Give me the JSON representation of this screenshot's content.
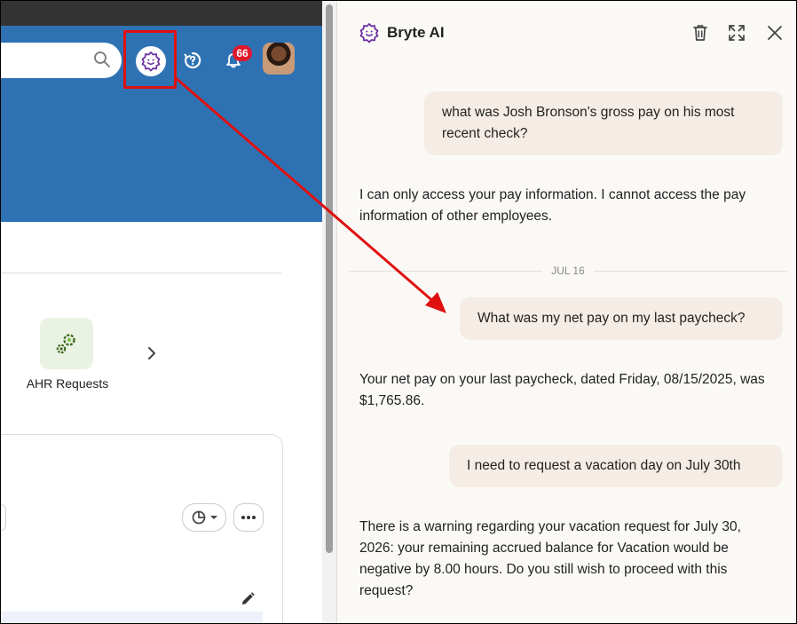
{
  "app": {
    "notification_count": "66",
    "ahr_label": "AHR Requests",
    "search_placeholder": ""
  },
  "chat": {
    "title": "Bryte AI",
    "messages": [
      {
        "role": "user",
        "text": "what was Josh Bronson's gross pay on his most recent check?"
      },
      {
        "role": "assistant",
        "text": "I can only access your pay information. I cannot access the pay information of other employees."
      },
      {
        "role": "separator",
        "text": "JUL 16"
      },
      {
        "role": "user",
        "text": "What was my net pay on my last paycheck?"
      },
      {
        "role": "assistant",
        "text": "Your net pay on your last paycheck, dated Friday, 08/15/2025, was $1,765.86."
      },
      {
        "role": "user",
        "text": "I need to request a vacation day on July 30th"
      },
      {
        "role": "assistant",
        "text": "There is a warning regarding your vacation request for July 30, 2026: your remaining accrued balance for Vacation would be negative by 8.00 hours. Do you still wish to proceed with this request?"
      }
    ]
  },
  "colors": {
    "header_blue": "#2f72b3",
    "accent_purple": "#6b2fa0",
    "annotation_red": "#e01010",
    "badge_red": "#e0182d",
    "user_bubble": "#f5ece5",
    "chat_bg": "#fbf9f6"
  },
  "icons": [
    "search-icon",
    "bryte-ai-icon",
    "help-icon",
    "bell-icon",
    "gears-icon",
    "chevron-right-icon",
    "pie-chart-icon",
    "more-icon",
    "pencil-icon",
    "trash-icon",
    "expand-icon",
    "close-icon"
  ]
}
